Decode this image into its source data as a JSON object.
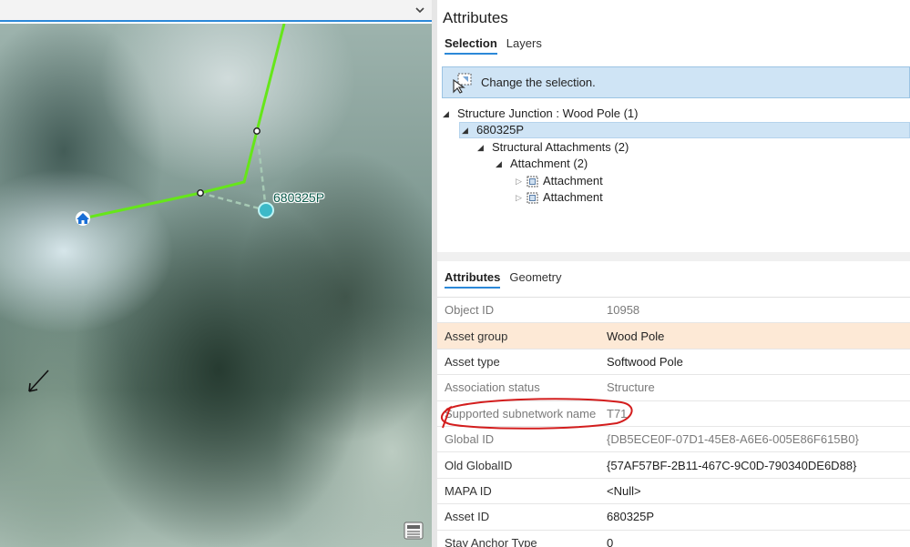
{
  "map": {
    "feature_label": "680325P",
    "dropdown_icon": "chevron-down-icon",
    "tool_icon": "attribute-table-icon",
    "colors": {
      "line": "#66e61a",
      "connector": "#a6c9b4",
      "point": "#3cb9c8",
      "house": "#1a6fd6"
    }
  },
  "attributes_pane": {
    "title": "Attributes",
    "selection_tabs": [
      "Selection",
      "Layers"
    ],
    "change_selection": "Change the selection.",
    "tree": {
      "root": "Structure Junction : Wood Pole (1)",
      "pole": "680325P",
      "group": "Structural Attachments (2)",
      "sub": "Attachment (2)",
      "children": [
        "Attachment",
        "Attachment"
      ]
    },
    "attr_tabs": [
      "Attributes",
      "Geometry"
    ],
    "fields": [
      {
        "name": "Object ID",
        "value": "10958"
      },
      {
        "name": "Asset group",
        "value": "Wood Pole"
      },
      {
        "name": "Asset type",
        "value": "Softwood Pole"
      },
      {
        "name": "Association status",
        "value": "Structure"
      },
      {
        "name": "Supported subnetwork name",
        "value": "T71"
      },
      {
        "name": "Global ID",
        "value": "{DB5ECE0F-07D1-45E8-A6E6-005E86F615B0}"
      },
      {
        "name": "Old GlobalID",
        "value": "{57AF57BF-2B11-467C-9C0D-790340DE6D88}"
      },
      {
        "name": "MAPA ID",
        "value": "<Null>"
      },
      {
        "name": "Asset ID",
        "value": "680325P"
      },
      {
        "name": "Stay Anchor Type",
        "value": "0"
      }
    ],
    "annotation_color": "#d31d1d"
  }
}
